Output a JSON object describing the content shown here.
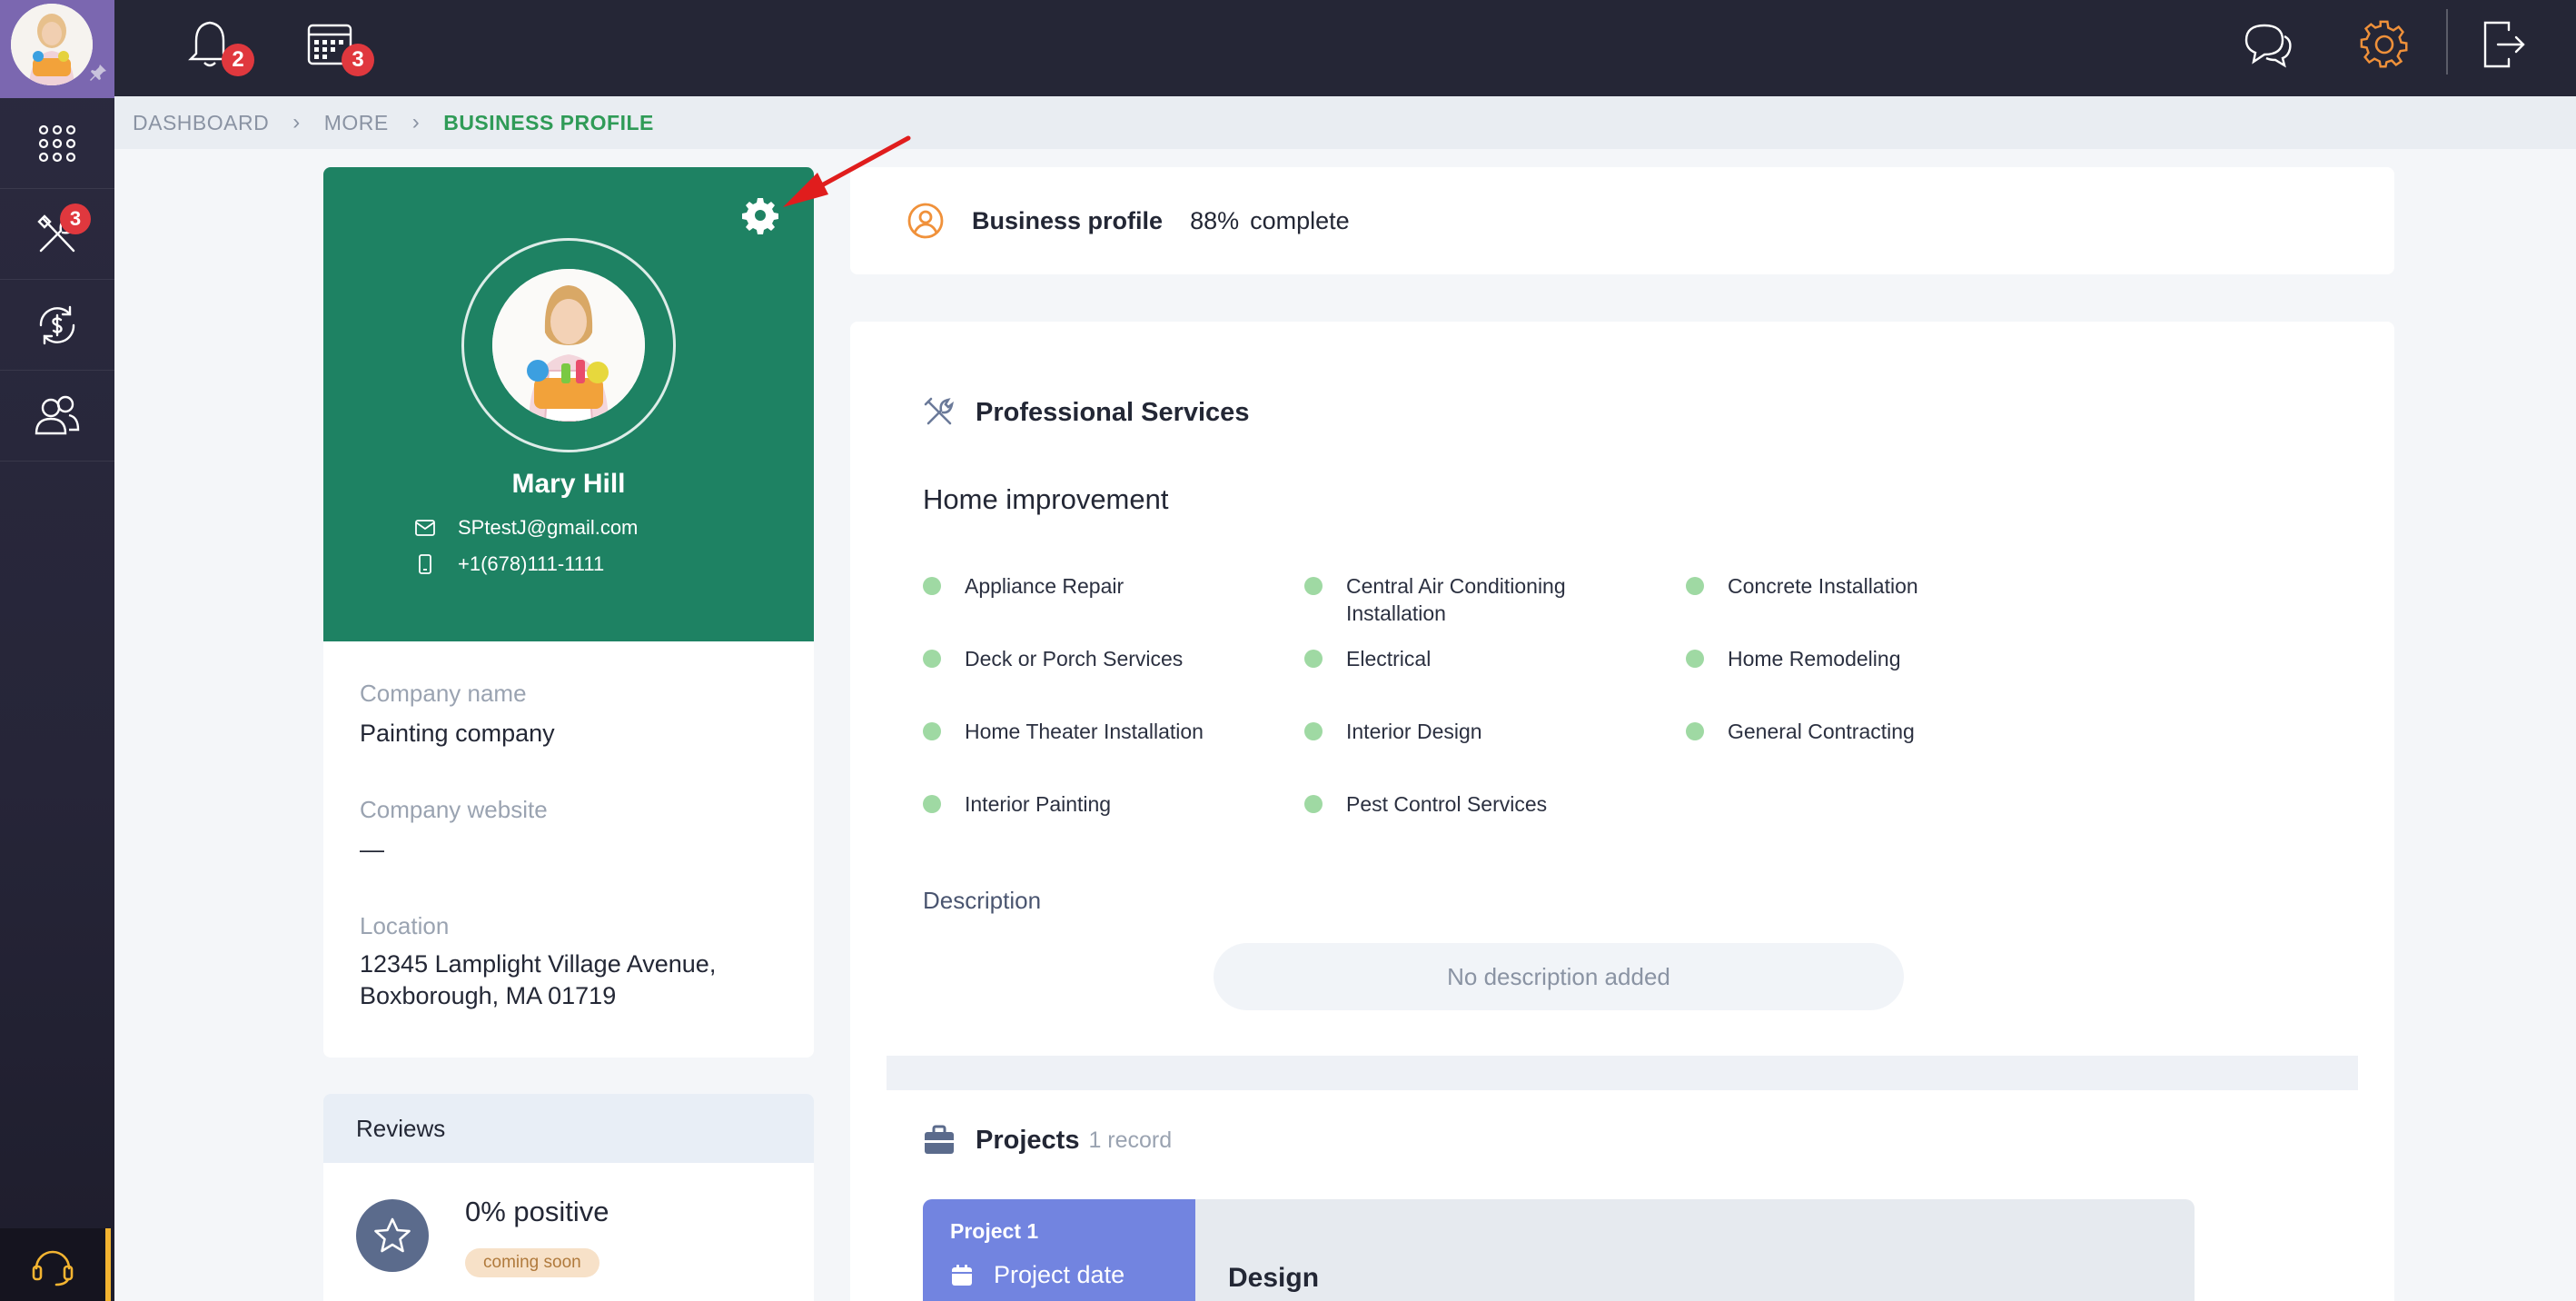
{
  "topbar": {
    "notifications_count": "2",
    "calendar_count": "3"
  },
  "sidebar": {
    "tools_badge": "3"
  },
  "breadcrumb": {
    "items": [
      "DASHBOARD",
      "MORE",
      "BUSINESS PROFILE"
    ]
  },
  "profile": {
    "name": "Mary Hill",
    "email": "SPtestJ@gmail.com",
    "phone": "+1(678)111-1111"
  },
  "company": {
    "name_label": "Company name",
    "name_value": "Painting company",
    "website_label": "Company website",
    "website_value": "—",
    "location_label": "Location",
    "location_line1": "12345 Lamplight Village Avenue,",
    "location_line2": "Boxborough, MA 01719"
  },
  "reviews": {
    "title": "Reviews",
    "positive": "0% positive",
    "badge": "coming soon"
  },
  "business_profile": {
    "title": "Business profile",
    "percent": "88%",
    "suffix": "complete",
    "progress": 0.88
  },
  "services": {
    "title": "Professional Services",
    "category": "Home improvement",
    "items": [
      "Appliance Repair",
      "Central Air Conditioning Installation",
      "Concrete Installation",
      "Deck or Porch Services",
      "Electrical",
      "Home Remodeling",
      "Home Theater Installation",
      "Interior Design",
      "General Contracting",
      "Interior Painting",
      "Pest Control Services"
    ]
  },
  "description": {
    "label": "Description",
    "empty": "No description added"
  },
  "projects": {
    "title": "Projects",
    "count": "1 record",
    "items": [
      {
        "name": "Project 1",
        "date_label": "Project date",
        "title": "Design"
      }
    ]
  },
  "colors": {
    "profile_green": "#1e8263",
    "accent_orange": "#f0913a",
    "badge_red": "#e0383e",
    "project_blue": "#7284e0",
    "service_dot": "#9fd9a3"
  }
}
